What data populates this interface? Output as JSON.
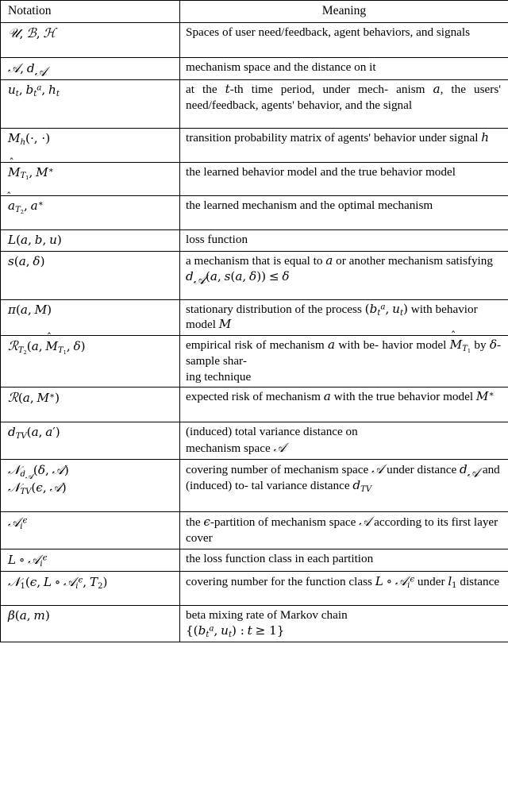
{
  "table": {
    "headers": {
      "notation": "Notation",
      "meaning": "Meaning"
    },
    "rows": [
      {
        "notation_text": "U, B, H",
        "meaning_text": "Spaces of user need/feedback, agent behaviors, and signals"
      },
      {
        "notation_text": "A, d_A",
        "meaning_text": "mechanism space and the distance on it"
      },
      {
        "notation_text": "u_t, b_t^a, h_t",
        "meaning_text": "at the t-th time period, under mechanism a, the users' need/feedback, agents' behavior, and the signal"
      },
      {
        "notation_text": "M_h(·, ·)",
        "meaning_text": "transition probability matrix of agents' behavior under signal h"
      },
      {
        "notation_text": "M̂_T1, M*",
        "meaning_text": "the learned behavior model and the true behavior model"
      },
      {
        "notation_text": "â_T2, a*",
        "meaning_text": "the learned mechanism and the optimal mechanism"
      },
      {
        "notation_text": "L(a, b, u)",
        "meaning_text": "loss function"
      },
      {
        "notation_text": "s(a, δ)",
        "meaning_text": "a mechanism that is equal to a or another mechanism satisfying d_A(a, s(a, δ)) ≤ δ"
      },
      {
        "notation_text": "π(a, M)",
        "meaning_text": "stationary distribution of the process (b_t^a, u_t) with behavior model M"
      },
      {
        "notation_text": "R_T2(a, M̂_T1, δ)",
        "meaning_text": "empirical risk of mechanism a with behavior model M̂_T1 by δ-sample sharing technique"
      },
      {
        "notation_text": "R(a, M*)",
        "meaning_text": "expected risk of mechanism a with the true behavior model M*"
      },
      {
        "notation_text": "d_TV(a, a')",
        "meaning_text": "(induced) total variance distance on mechanism space A"
      },
      {
        "notation_text": "N_dA(δ, A) / N_TV(ε, A)",
        "meaning_text": "covering number of mechanism space A under distance d_A and (induced) total variance distance d_TV"
      },
      {
        "notation_text": "A_i^ε",
        "meaning_text": "the ε-partition of mechanism space A according to its first layer cover"
      },
      {
        "notation_text": "L ∘ A_i^ε",
        "meaning_text": "the loss function class in each partition"
      },
      {
        "notation_text": "N_1(ε, L ∘ A_i^ε, T_2)",
        "meaning_text": "covering number for the function class L ∘ A_i^ε under l_1 distance"
      },
      {
        "notation_text": "β(a, m)",
        "meaning_text": "beta mixing rate of Markov chain {(b_t^a, u_t) : t ≥ 1}"
      }
    ]
  },
  "meaning_fragments": {
    "r1a": "Spaces of user need/feedback, agent",
    "r1b": "behaviors, and signals",
    "r2": "mechanism space and the distance on it",
    "r3a": "at the",
    "r3b": "-th time period, under mech-",
    "r3c": "anism",
    "r3d": ", the users' need/feedback,",
    "r3e": "agents' behavior, and the signal",
    "r4a": "transition probability matrix of agents'",
    "r4b": "behavior under signal",
    "r5a": "the learned behavior model and the true",
    "r5b": "behavior model",
    "r6a": "the learned mechanism and the optimal",
    "r6b": "mechanism",
    "r7": "loss function",
    "r8a": "a mechanism that is equal to",
    "r8b": "or another mechanism satisfying",
    "r9a": "stationary distribution of the process",
    "r9b": "with behavior model",
    "r10a": "empirical risk of mechanism",
    "r10b": "with be-",
    "r10c": "havior model",
    "r10d": "by",
    "r10e": "-sample shar-",
    "r10f": "ing technique",
    "r11a": "expected risk of mechanism",
    "r11b": "with the",
    "r11c": "true behavior model",
    "r12a": "(induced) total variance distance on",
    "r12b": "mechanism space",
    "r13a": "covering number of mechanism space",
    "r13b": "under distance",
    "r13c": "and (induced) to-",
    "r13d": "tal variance distance",
    "r14a": "the",
    "r14b": "-partition of mechanism space",
    "r14c": "according to its first layer cover",
    "r15": "the loss function class in each partition",
    "r16a": "covering number for the function class",
    "r16b": "under",
    "r16c": "distance",
    "r17a": "beta mixing rate of Markov chain"
  }
}
